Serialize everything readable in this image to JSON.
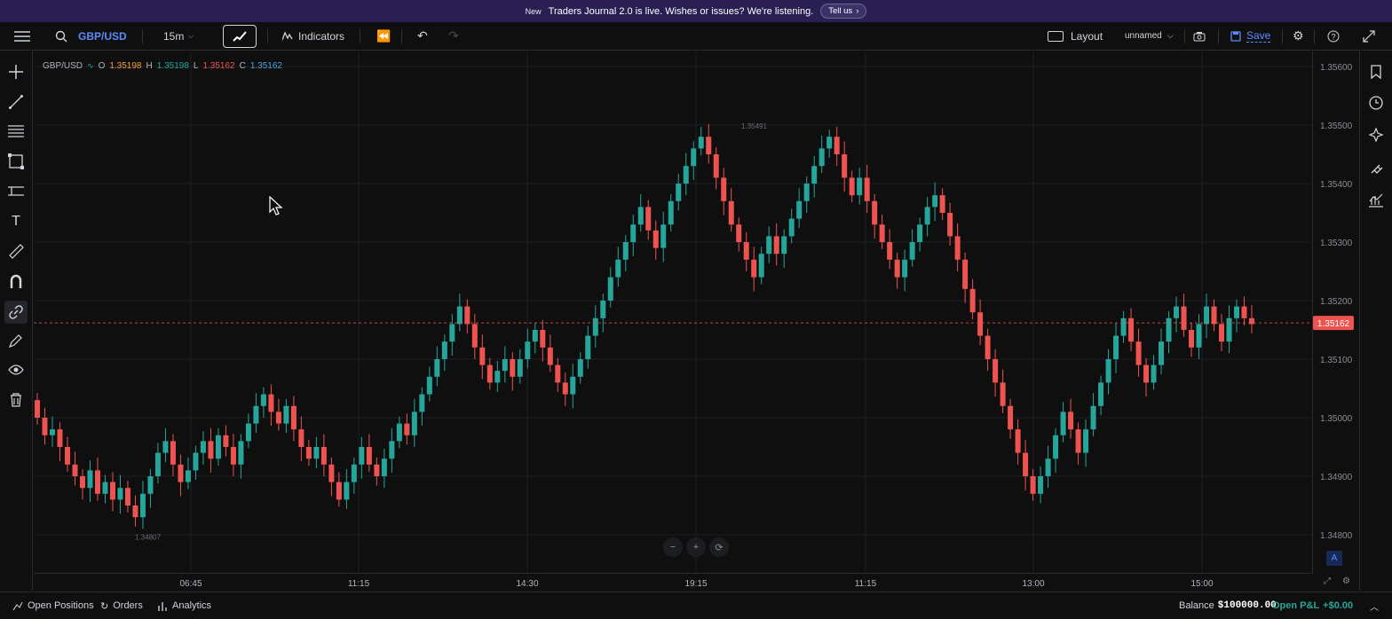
{
  "banner": {
    "badge": "New",
    "message": "Traders Journal 2.0 is live. Wishes or issues? We're listening.",
    "cta": "Tell us"
  },
  "toolbar": {
    "symbol": "GBP/USD",
    "interval": "15m",
    "indicators": "Indicators",
    "layout": "Layout",
    "layout_name": "unnamed",
    "save": "Save"
  },
  "legend": {
    "symbol": "GBP/USD",
    "o_label": "O",
    "o": "1.35198",
    "h_label": "H",
    "h": "1.35198",
    "l_label": "L",
    "l": "1.35162",
    "c_label": "C",
    "c": "1.35162"
  },
  "colors": {
    "up": "#26a69a",
    "down": "#ef5350",
    "accent": "#2962ff"
  },
  "price_axis": {
    "ticks": [
      "1.35600",
      "1.35500",
      "1.35400",
      "1.35300",
      "1.35200",
      "1.35100",
      "1.35000",
      "1.34900",
      "1.34800"
    ],
    "current": "1.35162",
    "auto": "A"
  },
  "time_axis": {
    "ticks": [
      "06:45",
      "11:15",
      "14:30",
      "19:15",
      "11:15",
      "13:00",
      "15:00"
    ]
  },
  "annotations": {
    "high": "1.35491",
    "low": "1.34807"
  },
  "zoom": {
    "minus": "−",
    "plus": "+"
  },
  "bottombar": {
    "open_positions": "Open Positions",
    "orders": "Orders",
    "analytics": "Analytics",
    "balance_label": "Balance",
    "balance": "$100000.00",
    "pnl_label": "Open P&L",
    "pnl": "+$0.00"
  },
  "chart_data": {
    "type": "candlestick",
    "symbol": "GBP/USD",
    "interval": "15m",
    "ylim": [
      1.3475,
      1.3565
    ],
    "grid": true,
    "closes": [
      1.35,
      1.3497,
      1.3498,
      1.3495,
      1.3492,
      1.349,
      1.3488,
      1.3491,
      1.3487,
      1.3489,
      1.3486,
      1.3488,
      1.3485,
      1.3483,
      1.3487,
      1.349,
      1.3494,
      1.3496,
      1.3492,
      1.3489,
      1.3491,
      1.3494,
      1.3496,
      1.3493,
      1.3497,
      1.3495,
      1.3492,
      1.3496,
      1.3499,
      1.3502,
      1.3504,
      1.3501,
      1.3499,
      1.3502,
      1.3498,
      1.3495,
      1.3493,
      1.3495,
      1.3492,
      1.3489,
      1.3486,
      1.3489,
      1.3492,
      1.3495,
      1.3492,
      1.349,
      1.3493,
      1.3496,
      1.3499,
      1.3497,
      1.3501,
      1.3504,
      1.3507,
      1.351,
      1.3513,
      1.3516,
      1.3519,
      1.3516,
      1.3512,
      1.3509,
      1.3506,
      1.3508,
      1.351,
      1.3507,
      1.351,
      1.3513,
      1.3515,
      1.3512,
      1.3509,
      1.3506,
      1.3504,
      1.3507,
      1.351,
      1.3514,
      1.3517,
      1.352,
      1.3524,
      1.3527,
      1.353,
      1.3533,
      1.3536,
      1.3532,
      1.3529,
      1.3533,
      1.3537,
      1.354,
      1.3543,
      1.3546,
      1.3548,
      1.3545,
      1.3541,
      1.3537,
      1.3533,
      1.353,
      1.3527,
      1.3524,
      1.3528,
      1.3531,
      1.3528,
      1.3531,
      1.3534,
      1.3537,
      1.354,
      1.3543,
      1.3546,
      1.3548,
      1.3545,
      1.3541,
      1.3538,
      1.3541,
      1.3537,
      1.3533,
      1.353,
      1.3527,
      1.3524,
      1.3527,
      1.353,
      1.3533,
      1.3536,
      1.3538,
      1.3535,
      1.3531,
      1.3527,
      1.3522,
      1.3518,
      1.3514,
      1.351,
      1.3506,
      1.3502,
      1.3498,
      1.3494,
      1.349,
      1.3487,
      1.349,
      1.3493,
      1.3497,
      1.3501,
      1.3498,
      1.3494,
      1.3498,
      1.3502,
      1.3506,
      1.351,
      1.3514,
      1.3517,
      1.3513,
      1.3509,
      1.3506,
      1.3509,
      1.3513,
      1.3517,
      1.3519,
      1.3515,
      1.3512,
      1.3516,
      1.3519,
      1.3516,
      1.3513,
      1.3517,
      1.3519,
      1.3517,
      1.3516
    ]
  }
}
